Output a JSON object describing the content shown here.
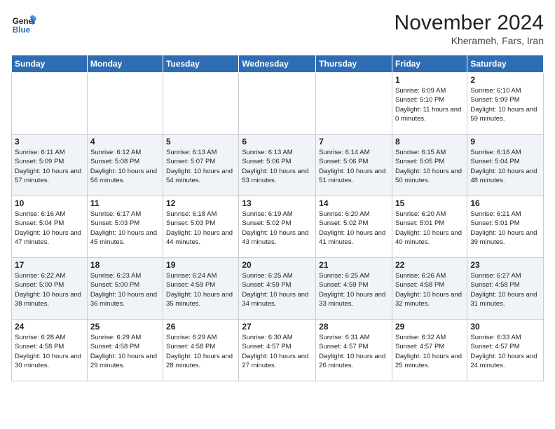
{
  "header": {
    "logo_line1": "General",
    "logo_line2": "Blue",
    "month_title": "November 2024",
    "location": "Kherameh, Fars, Iran"
  },
  "weekdays": [
    "Sunday",
    "Monday",
    "Tuesday",
    "Wednesday",
    "Thursday",
    "Friday",
    "Saturday"
  ],
  "weeks": [
    [
      {
        "day": "",
        "info": ""
      },
      {
        "day": "",
        "info": ""
      },
      {
        "day": "",
        "info": ""
      },
      {
        "day": "",
        "info": ""
      },
      {
        "day": "",
        "info": ""
      },
      {
        "day": "1",
        "info": "Sunrise: 6:09 AM\nSunset: 5:10 PM\nDaylight: 11 hours and 0 minutes."
      },
      {
        "day": "2",
        "info": "Sunrise: 6:10 AM\nSunset: 5:09 PM\nDaylight: 10 hours and 59 minutes."
      }
    ],
    [
      {
        "day": "3",
        "info": "Sunrise: 6:11 AM\nSunset: 5:09 PM\nDaylight: 10 hours and 57 minutes."
      },
      {
        "day": "4",
        "info": "Sunrise: 6:12 AM\nSunset: 5:08 PM\nDaylight: 10 hours and 56 minutes."
      },
      {
        "day": "5",
        "info": "Sunrise: 6:13 AM\nSunset: 5:07 PM\nDaylight: 10 hours and 54 minutes."
      },
      {
        "day": "6",
        "info": "Sunrise: 6:13 AM\nSunset: 5:06 PM\nDaylight: 10 hours and 53 minutes."
      },
      {
        "day": "7",
        "info": "Sunrise: 6:14 AM\nSunset: 5:06 PM\nDaylight: 10 hours and 51 minutes."
      },
      {
        "day": "8",
        "info": "Sunrise: 6:15 AM\nSunset: 5:05 PM\nDaylight: 10 hours and 50 minutes."
      },
      {
        "day": "9",
        "info": "Sunrise: 6:16 AM\nSunset: 5:04 PM\nDaylight: 10 hours and 48 minutes."
      }
    ],
    [
      {
        "day": "10",
        "info": "Sunrise: 6:16 AM\nSunset: 5:04 PM\nDaylight: 10 hours and 47 minutes."
      },
      {
        "day": "11",
        "info": "Sunrise: 6:17 AM\nSunset: 5:03 PM\nDaylight: 10 hours and 45 minutes."
      },
      {
        "day": "12",
        "info": "Sunrise: 6:18 AM\nSunset: 5:03 PM\nDaylight: 10 hours and 44 minutes."
      },
      {
        "day": "13",
        "info": "Sunrise: 6:19 AM\nSunset: 5:02 PM\nDaylight: 10 hours and 43 minutes."
      },
      {
        "day": "14",
        "info": "Sunrise: 6:20 AM\nSunset: 5:02 PM\nDaylight: 10 hours and 41 minutes."
      },
      {
        "day": "15",
        "info": "Sunrise: 6:20 AM\nSunset: 5:01 PM\nDaylight: 10 hours and 40 minutes."
      },
      {
        "day": "16",
        "info": "Sunrise: 6:21 AM\nSunset: 5:01 PM\nDaylight: 10 hours and 39 minutes."
      }
    ],
    [
      {
        "day": "17",
        "info": "Sunrise: 6:22 AM\nSunset: 5:00 PM\nDaylight: 10 hours and 38 minutes."
      },
      {
        "day": "18",
        "info": "Sunrise: 6:23 AM\nSunset: 5:00 PM\nDaylight: 10 hours and 36 minutes."
      },
      {
        "day": "19",
        "info": "Sunrise: 6:24 AM\nSunset: 4:59 PM\nDaylight: 10 hours and 35 minutes."
      },
      {
        "day": "20",
        "info": "Sunrise: 6:25 AM\nSunset: 4:59 PM\nDaylight: 10 hours and 34 minutes."
      },
      {
        "day": "21",
        "info": "Sunrise: 6:25 AM\nSunset: 4:59 PM\nDaylight: 10 hours and 33 minutes."
      },
      {
        "day": "22",
        "info": "Sunrise: 6:26 AM\nSunset: 4:58 PM\nDaylight: 10 hours and 32 minutes."
      },
      {
        "day": "23",
        "info": "Sunrise: 6:27 AM\nSunset: 4:58 PM\nDaylight: 10 hours and 31 minutes."
      }
    ],
    [
      {
        "day": "24",
        "info": "Sunrise: 6:28 AM\nSunset: 4:58 PM\nDaylight: 10 hours and 30 minutes."
      },
      {
        "day": "25",
        "info": "Sunrise: 6:29 AM\nSunset: 4:58 PM\nDaylight: 10 hours and 29 minutes."
      },
      {
        "day": "26",
        "info": "Sunrise: 6:29 AM\nSunset: 4:58 PM\nDaylight: 10 hours and 28 minutes."
      },
      {
        "day": "27",
        "info": "Sunrise: 6:30 AM\nSunset: 4:57 PM\nDaylight: 10 hours and 27 minutes."
      },
      {
        "day": "28",
        "info": "Sunrise: 6:31 AM\nSunset: 4:57 PM\nDaylight: 10 hours and 26 minutes."
      },
      {
        "day": "29",
        "info": "Sunrise: 6:32 AM\nSunset: 4:57 PM\nDaylight: 10 hours and 25 minutes."
      },
      {
        "day": "30",
        "info": "Sunrise: 6:33 AM\nSunset: 4:57 PM\nDaylight: 10 hours and 24 minutes."
      }
    ]
  ]
}
